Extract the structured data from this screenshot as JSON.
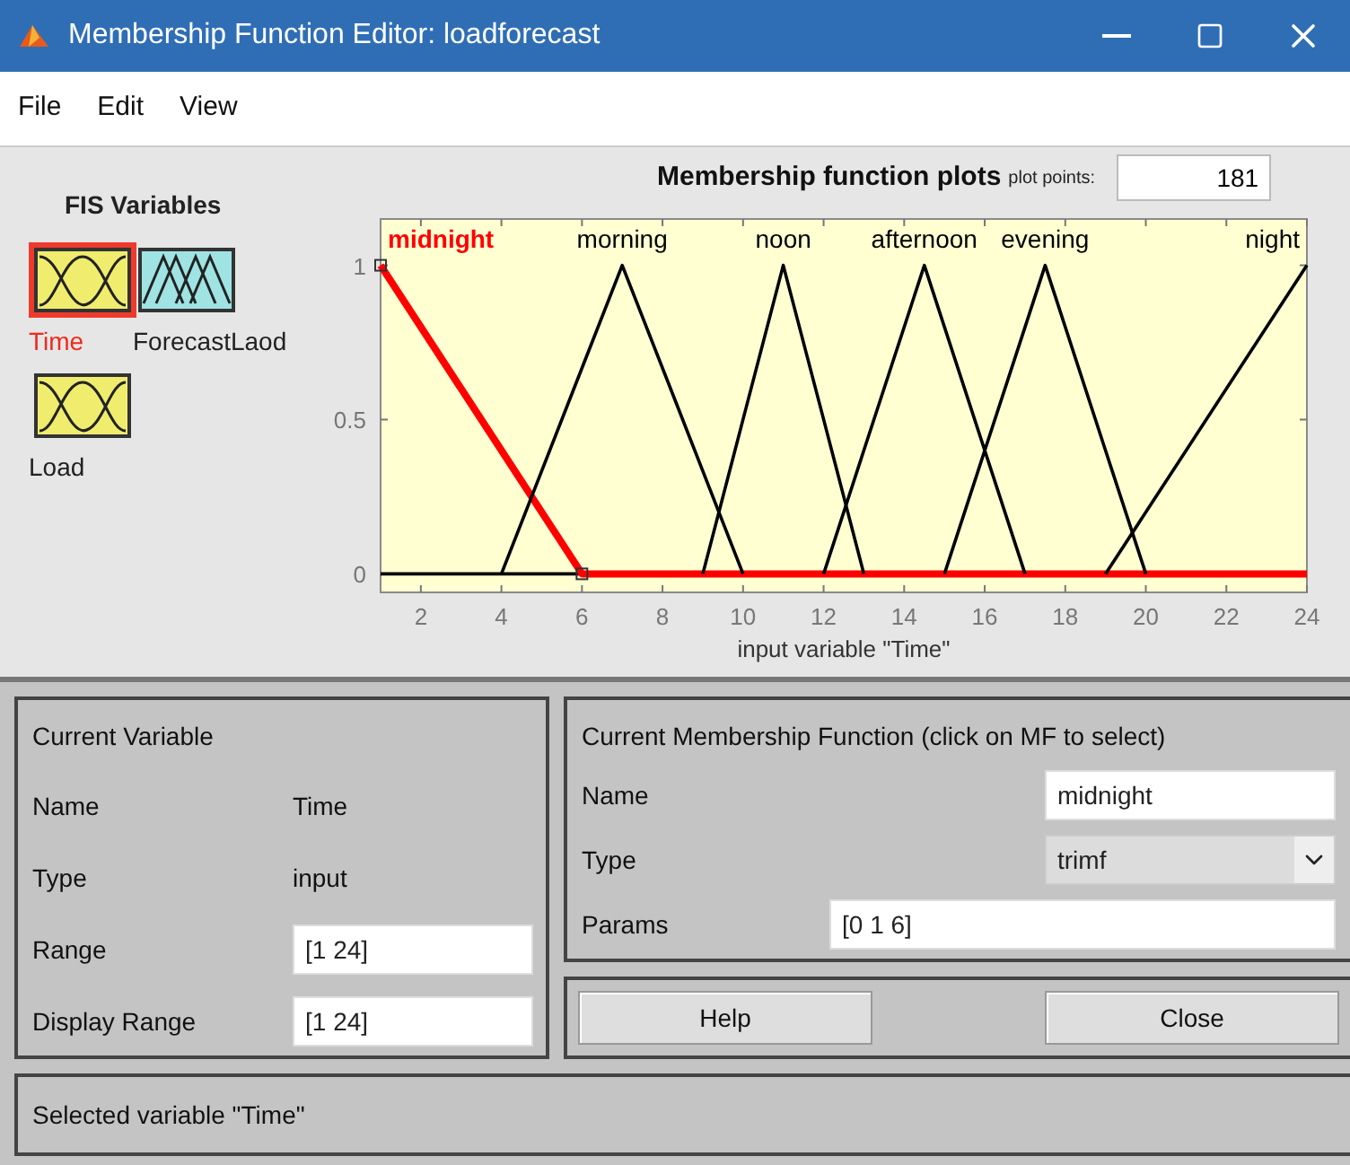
{
  "window": {
    "title": "Membership Function Editor: loadforecast"
  },
  "menu": [
    "File",
    "Edit",
    "View"
  ],
  "fis_variables": {
    "title": "FIS Variables",
    "items": [
      {
        "name": "Time",
        "kind": "input",
        "selected": true
      },
      {
        "name": "ForecastLaod",
        "kind": "output",
        "selected": false
      },
      {
        "name": "Load",
        "kind": "input",
        "selected": false
      }
    ]
  },
  "plot": {
    "plot_points_label": "plot points:",
    "plot_points": "181",
    "chart_data": {
      "type": "line",
      "title": "Membership function plots",
      "xlabel": "input variable \"Time\"",
      "x": [
        1,
        4,
        6,
        7,
        9,
        10,
        11,
        12,
        13,
        14.5,
        15,
        17,
        17.5,
        19,
        20,
        24
      ],
      "xlim": [
        1,
        24
      ],
      "ylim": [
        -0.06,
        1.15
      ],
      "xticks": [
        2,
        4,
        6,
        8,
        10,
        12,
        14,
        16,
        18,
        20,
        22,
        24
      ],
      "yticks": [
        0,
        0.5,
        1
      ],
      "series": [
        {
          "name": "midnight",
          "color": "#ff0000",
          "values": [
            1,
            0.4,
            0,
            0,
            0,
            0,
            0,
            0,
            0,
            0,
            0,
            0,
            0,
            0,
            0,
            0
          ]
        },
        {
          "name": "morning",
          "color": "#000000",
          "values": [
            null,
            0,
            0.667,
            1,
            0.333,
            0,
            null,
            null,
            null,
            null,
            null,
            null,
            null,
            null,
            null,
            null
          ]
        },
        {
          "name": "noon",
          "color": "#000000",
          "values": [
            null,
            null,
            null,
            null,
            0,
            0.5,
            1,
            0.5,
            0,
            null,
            null,
            null,
            null,
            null,
            null,
            null
          ]
        },
        {
          "name": "afternoon",
          "color": "#000000",
          "values": [
            null,
            null,
            null,
            null,
            null,
            null,
            null,
            0,
            0.4,
            1,
            0.8,
            0,
            null,
            null,
            null,
            null
          ]
        },
        {
          "name": "evening",
          "color": "#000000",
          "values": [
            null,
            null,
            null,
            null,
            null,
            null,
            null,
            null,
            null,
            null,
            0,
            0.8,
            1,
            0.4,
            0,
            null
          ]
        },
        {
          "name": "night",
          "color": "#000000",
          "values": [
            null,
            null,
            null,
            null,
            null,
            null,
            null,
            null,
            null,
            null,
            null,
            null,
            null,
            0,
            0.2,
            1
          ]
        }
      ]
    }
  },
  "current_variable": {
    "title": "Current Variable",
    "name_label": "Name",
    "name": "Time",
    "type_label": "Type",
    "type": "input",
    "range_label": "Range",
    "range": "[1 24]",
    "display_range_label": "Display Range",
    "display_range": "[1 24]"
  },
  "current_mf": {
    "title": "Current Membership Function (click on MF to select)",
    "name_label": "Name",
    "name": "midnight",
    "type_label": "Type",
    "type": "trimf",
    "params_label": "Params",
    "params": "[0 1 6]"
  },
  "buttons": [
    "Help",
    "Close"
  ],
  "status": "Selected variable \"Time\""
}
